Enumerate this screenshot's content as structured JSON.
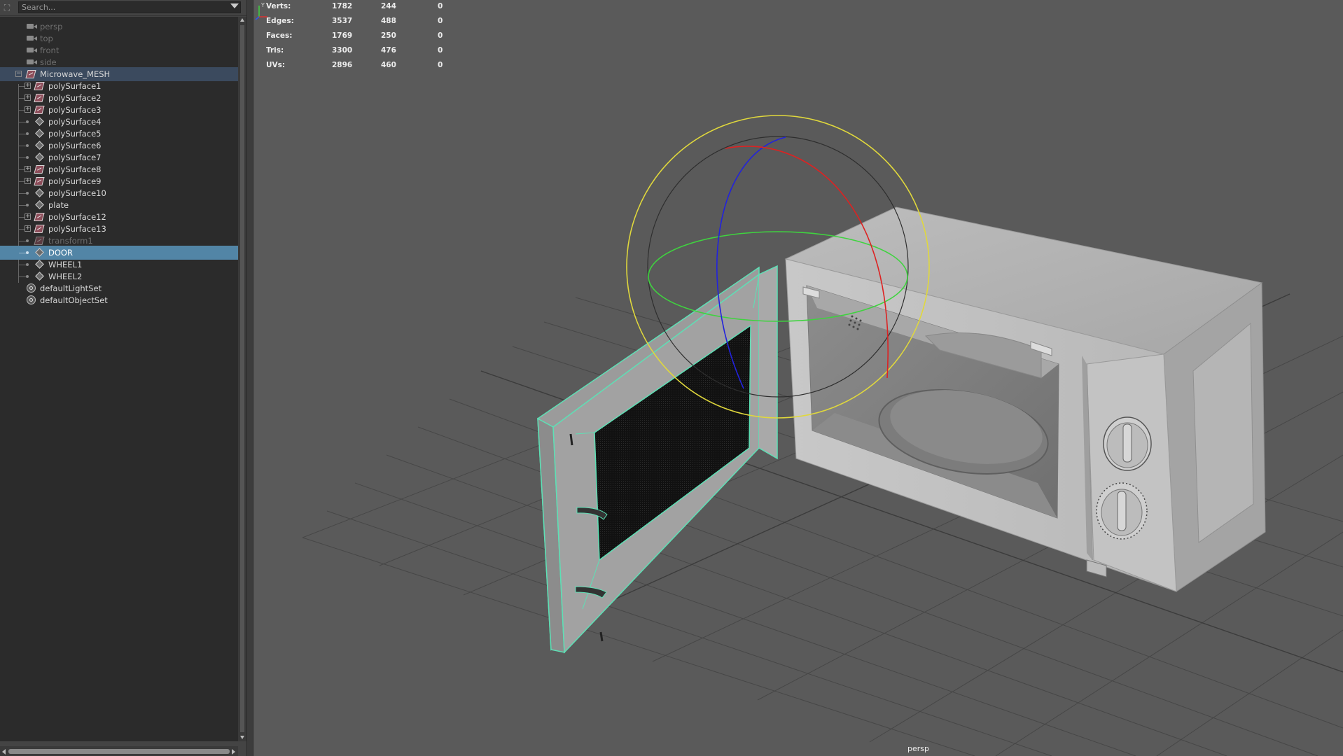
{
  "outliner": {
    "search_placeholder": "Search...",
    "items": [
      {
        "label": "persp",
        "type": "camera",
        "dim": true
      },
      {
        "label": "top",
        "type": "camera",
        "dim": true
      },
      {
        "label": "front",
        "type": "camera",
        "dim": true
      },
      {
        "label": "side",
        "type": "camera",
        "dim": true
      },
      {
        "label": "Microwave_MESH",
        "type": "mesh-group"
      },
      {
        "label": "polySurface1",
        "type": "mesh"
      },
      {
        "label": "polySurface2",
        "type": "mesh"
      },
      {
        "label": "polySurface3",
        "type": "mesh"
      },
      {
        "label": "polySurface4",
        "type": "transform"
      },
      {
        "label": "polySurface5",
        "type": "transform"
      },
      {
        "label": "polySurface6",
        "type": "transform"
      },
      {
        "label": "polySurface7",
        "type": "transform"
      },
      {
        "label": "polySurface8",
        "type": "mesh"
      },
      {
        "label": "polySurface9",
        "type": "mesh"
      },
      {
        "label": "polySurface10",
        "type": "transform"
      },
      {
        "label": "plate",
        "type": "transform"
      },
      {
        "label": "polySurface12",
        "type": "mesh"
      },
      {
        "label": "polySurface13",
        "type": "mesh"
      },
      {
        "label": "transform1",
        "type": "mesh",
        "dim": true
      },
      {
        "label": "DOOR",
        "type": "transform",
        "selected": true
      },
      {
        "label": "WHEEL1",
        "type": "transform"
      },
      {
        "label": "WHEEL2",
        "type": "transform"
      },
      {
        "label": "defaultLightSet",
        "type": "set"
      },
      {
        "label": "defaultObjectSet",
        "type": "set"
      }
    ]
  },
  "hud": {
    "rows": [
      {
        "label": "Verts:",
        "v1": "1782",
        "v2": "244",
        "v3": "0"
      },
      {
        "label": "Edges:",
        "v1": "3537",
        "v2": "488",
        "v3": "0"
      },
      {
        "label": "Faces:",
        "v1": "1769",
        "v2": "250",
        "v3": "0"
      },
      {
        "label": "Tris:",
        "v1": "3300",
        "v2": "476",
        "v3": "0"
      },
      {
        "label": "UVs:",
        "v1": "2896",
        "v2": "460",
        "v3": "0"
      }
    ]
  },
  "viewport": {
    "camera_label": "persp",
    "axis_y_label": "Y",
    "selection_color": "#5de0b5",
    "background_color": "#5a5a5a",
    "grid_color": "#4a4a4a"
  }
}
